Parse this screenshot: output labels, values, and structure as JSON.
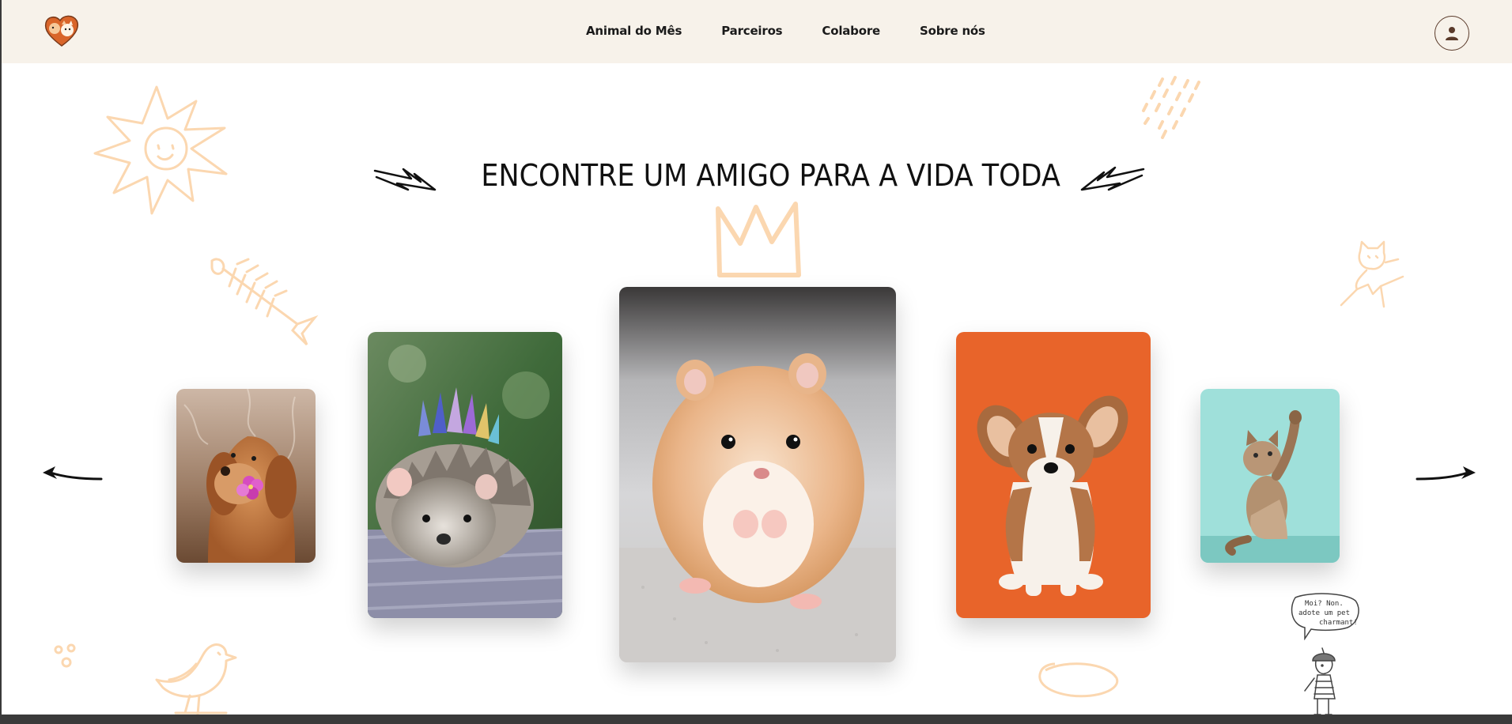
{
  "header": {
    "logo_icon": "cat-dog-heart-logo-icon",
    "nav": [
      {
        "label": "Animal do Mês"
      },
      {
        "label": "Parceiros"
      },
      {
        "label": "Colabore"
      },
      {
        "label": "Sobre nós"
      }
    ],
    "profile_icon": "user-icon"
  },
  "hero": {
    "title": "ENCONTRE UM AMIGO PARA A VIDA TODA"
  },
  "carousel": {
    "prev_icon": "arrow-left-icon",
    "next_icon": "arrow-right-icon",
    "cards": [
      {
        "animal": "golden retriever with flower"
      },
      {
        "animal": "hedgehog with crown"
      },
      {
        "animal": "hamster"
      },
      {
        "animal": "corgi puppy"
      },
      {
        "animal": "kitten"
      }
    ]
  },
  "speech_bubble": {
    "lines": [
      "Moi? Non.",
      "adote um pet",
      "charmant!"
    ]
  },
  "colors": {
    "header_bg": "#f7f2ea",
    "doodle": "#fbd7b0",
    "accent_brown": "#5a3a2a",
    "text": "#111111"
  }
}
